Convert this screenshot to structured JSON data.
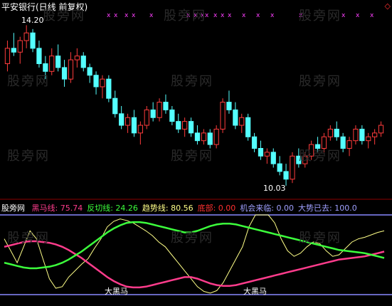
{
  "header": {
    "title": "平安银行(日线 前复权)"
  },
  "watermark": "股旁网",
  "price_panel": {
    "high_label": "14.20",
    "low_label": "10.03",
    "candles": [
      [
        13.2,
        13.8,
        13.0,
        13.6
      ],
      [
        13.6,
        14.0,
        13.4,
        13.5
      ],
      [
        13.5,
        13.9,
        13.2,
        13.8
      ],
      [
        13.8,
        14.2,
        13.6,
        14.0
      ],
      [
        14.0,
        14.1,
        13.5,
        13.6
      ],
      [
        13.6,
        13.8,
        13.1,
        13.2
      ],
      [
        13.2,
        13.4,
        12.8,
        13.0
      ],
      [
        13.0,
        13.6,
        12.9,
        13.4
      ],
      [
        13.4,
        13.7,
        13.0,
        13.1
      ],
      [
        13.1,
        13.3,
        12.6,
        12.8
      ],
      [
        12.8,
        13.5,
        12.7,
        13.3
      ],
      [
        13.3,
        13.6,
        13.1,
        13.4
      ],
      [
        13.4,
        13.5,
        13.0,
        13.1
      ],
      [
        13.1,
        13.2,
        12.7,
        12.9
      ],
      [
        12.9,
        13.0,
        12.4,
        12.6
      ],
      [
        12.6,
        12.9,
        12.3,
        12.8
      ],
      [
        12.8,
        12.9,
        12.2,
        12.3
      ],
      [
        12.3,
        12.5,
        11.8,
        11.9
      ],
      [
        11.9,
        12.1,
        11.5,
        11.6
      ],
      [
        11.6,
        11.9,
        11.4,
        11.8
      ],
      [
        11.8,
        12.0,
        11.3,
        11.4
      ],
      [
        11.4,
        11.7,
        11.1,
        11.6
      ],
      [
        11.6,
        12.1,
        11.5,
        12.0
      ],
      [
        12.0,
        12.2,
        11.7,
        11.8
      ],
      [
        11.8,
        12.3,
        11.7,
        12.2
      ],
      [
        12.2,
        12.4,
        11.9,
        12.0
      ],
      [
        12.0,
        12.1,
        11.6,
        11.7
      ],
      [
        11.7,
        11.9,
        11.4,
        11.5
      ],
      [
        11.5,
        11.8,
        11.3,
        11.7
      ],
      [
        11.7,
        11.8,
        11.3,
        11.4
      ],
      [
        11.4,
        11.6,
        11.1,
        11.2
      ],
      [
        11.2,
        11.5,
        11.1,
        11.4
      ],
      [
        11.4,
        11.5,
        11.0,
        11.1
      ],
      [
        11.1,
        11.6,
        11.0,
        11.5
      ],
      [
        11.5,
        12.3,
        11.4,
        12.2
      ],
      [
        12.2,
        12.5,
        11.9,
        12.0
      ],
      [
        12.0,
        12.2,
        11.5,
        11.6
      ],
      [
        11.6,
        11.9,
        11.4,
        11.8
      ],
      [
        11.8,
        11.9,
        11.2,
        11.3
      ],
      [
        11.3,
        11.4,
        10.9,
        11.0
      ],
      [
        11.0,
        11.2,
        10.7,
        10.8
      ],
      [
        10.8,
        11.0,
        10.6,
        10.9
      ],
      [
        10.9,
        11.0,
        10.5,
        10.6
      ],
      [
        10.6,
        10.8,
        10.3,
        10.4
      ],
      [
        10.4,
        10.6,
        10.03,
        10.2
      ],
      [
        10.2,
        10.9,
        10.1,
        10.8
      ],
      [
        10.8,
        11.0,
        10.5,
        10.6
      ],
      [
        10.6,
        10.9,
        10.5,
        10.8
      ],
      [
        10.8,
        11.2,
        10.7,
        11.1
      ],
      [
        11.1,
        11.3,
        10.9,
        11.0
      ],
      [
        11.0,
        11.4,
        10.9,
        11.3
      ],
      [
        11.3,
        11.6,
        11.2,
        11.5
      ],
      [
        11.5,
        11.7,
        11.2,
        11.3
      ],
      [
        11.3,
        11.4,
        10.9,
        11.0
      ],
      [
        11.0,
        11.3,
        10.8,
        11.2
      ],
      [
        11.2,
        11.6,
        11.1,
        11.5
      ],
      [
        11.5,
        11.6,
        11.1,
        11.2
      ],
      [
        11.2,
        11.4,
        11.0,
        11.3
      ],
      [
        11.3,
        11.5,
        11.1,
        11.4
      ],
      [
        11.4,
        11.7,
        11.3,
        11.6
      ]
    ]
  },
  "legend": {
    "name": "股旁网",
    "items": [
      {
        "label": "黑马线: ",
        "value": "75.74",
        "color": "#ff3c8c"
      },
      {
        "label": "反切线: ",
        "value": "24.26",
        "color": "#3cff3c"
      },
      {
        "label": "趋势线: ",
        "value": "80.56",
        "color": "#ffff88"
      },
      {
        "label": "底部: ",
        "value": "0.00",
        "color": "#ff3030"
      },
      {
        "label": "机会来临: ",
        "value": "0.00",
        "color": "#a0a0ff"
      },
      {
        "label": "大势已去: ",
        "value": "100.0",
        "color": "#a0a0ff"
      }
    ]
  },
  "indicator": {
    "mark_label": "大黑马",
    "red": [
      60,
      62,
      64,
      66,
      67,
      67,
      66,
      65,
      63,
      60,
      56,
      51,
      46,
      40,
      34,
      28,
      22,
      17,
      13,
      10,
      9,
      9,
      10,
      12,
      14,
      16,
      18,
      20,
      22,
      22,
      20,
      17,
      14,
      12,
      11,
      11,
      12,
      14,
      16,
      18,
      20,
      22,
      24,
      26,
      28,
      30,
      32,
      34,
      36,
      38,
      40,
      42,
      44,
      45,
      46,
      47,
      48,
      50,
      52,
      54
    ],
    "green": [
      40,
      38,
      36,
      34,
      33,
      33,
      34,
      35,
      37,
      40,
      44,
      49,
      54,
      60,
      66,
      72,
      78,
      83,
      87,
      90,
      91,
      91,
      90,
      88,
      86,
      84,
      82,
      80,
      78,
      78,
      80,
      83,
      86,
      88,
      89,
      89,
      88,
      86,
      84,
      82,
      80,
      78,
      76,
      74,
      72,
      70,
      68,
      66,
      64,
      62,
      60,
      58,
      56,
      55,
      54,
      53,
      52,
      50,
      48,
      46
    ],
    "yellow": [
      70,
      55,
      40,
      60,
      80,
      70,
      45,
      20,
      8,
      10,
      22,
      30,
      38,
      45,
      58,
      70,
      85,
      92,
      95,
      93,
      90,
      85,
      80,
      74,
      66,
      60,
      50,
      40,
      30,
      20,
      10,
      4,
      2,
      5,
      15,
      30,
      45,
      60,
      85,
      100,
      100,
      100,
      90,
      70,
      55,
      48,
      52,
      60,
      66,
      64,
      55,
      48,
      50,
      58,
      66,
      70,
      72,
      75,
      78,
      80
    ]
  }
}
